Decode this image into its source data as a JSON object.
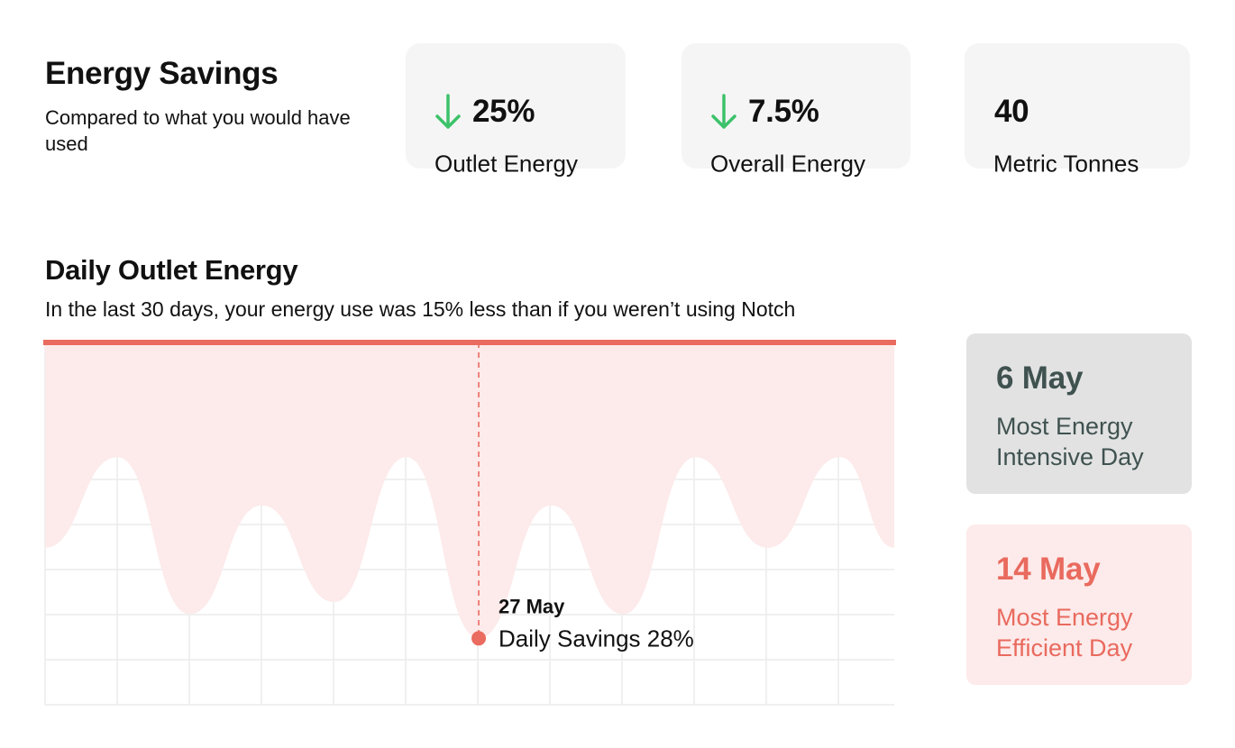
{
  "summary": {
    "title": "Energy Savings",
    "subtitle": "Compared to what you would have used"
  },
  "stats": [
    {
      "value": "25%",
      "label": "Outlet Energy",
      "icon": "arrow-down-icon",
      "icon_color": "#3cc26a"
    },
    {
      "value": "7.5%",
      "label": "Overall Energy",
      "icon": "arrow-down-icon",
      "icon_color": "#3cc26a"
    },
    {
      "value": "40",
      "label": "Metric Tonnes"
    }
  ],
  "daily": {
    "title": "Daily Outlet Energy",
    "subtitle": "In the last 30 days, your energy use was 15% less than if you weren’t using Notch"
  },
  "chart_data": {
    "type": "area",
    "title": "Daily Outlet Energy",
    "grid": true,
    "colors": {
      "line": "#ea6b5f",
      "fill": "#fdeaea",
      "grid": "#ececec",
      "marker": "#ea6b5f"
    },
    "x": [
      0,
      80,
      160,
      240,
      320,
      400,
      480,
      560,
      640,
      720,
      800,
      880,
      940
    ],
    "reference_value": 100,
    "values": [
      66,
      81,
      55,
      73,
      57,
      81,
      51,
      73,
      55,
      81,
      66,
      81,
      66
    ],
    "ylim": [
      40,
      100
    ],
    "highlight": {
      "x": 480,
      "value": 51,
      "date": "27 May",
      "label": "Daily Savings 28%"
    }
  },
  "insights": {
    "intensive": {
      "date": "6 May",
      "label": "Most Energy Intensive Day"
    },
    "efficient": {
      "date": "14 May",
      "label": "Most Energy Efficient Day"
    }
  }
}
